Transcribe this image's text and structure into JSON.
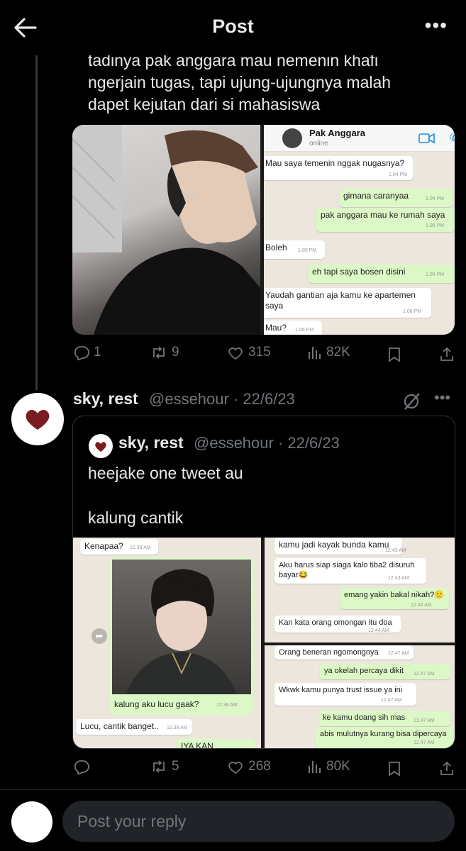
{
  "header": {
    "title": "Post"
  },
  "tweet1": {
    "text_lines": [
      "tadinya pak anggara mau nemenin khafi",
      "ngerjain tugas, tapi ujung-ujungnya malah",
      "dapet kejutan dari si mahasiswa"
    ],
    "chat": {
      "contact_name": "Pak Anggara",
      "status": "online",
      "messages": [
        {
          "dir": "in",
          "text": "Mau saya temenin nggak nugasnya?",
          "time": "1.04 PM"
        },
        {
          "dir": "out",
          "text": "gimana caranyaa",
          "time": "1.04 PM"
        },
        {
          "dir": "out",
          "text": "pak anggara mau ke rumah saya",
          "time": "1.05 PM"
        },
        {
          "dir": "in",
          "text": "Boleh",
          "time": "1.05 PM"
        },
        {
          "dir": "out",
          "text": "eh tapi saya bosen disini",
          "time": "1.06 PM"
        },
        {
          "dir": "in",
          "text": "Yaudah gantian aja kamu ke apartemen",
          "text2": "saya",
          "time": "1.06 PM"
        },
        {
          "dir": "in",
          "text": "Mau?",
          "time": "1.06 PM"
        }
      ]
    },
    "stats": {
      "replies": "1",
      "reposts": "9",
      "likes": "315",
      "views": "82K"
    }
  },
  "tweet2": {
    "name": "sky, rest",
    "handle_date": "@essehour · 22/6/23",
    "quote": {
      "name": "sky, rest",
      "handle_date": "@essehour · 22/6/23",
      "text1": "heejake one tweet au",
      "text2": "kalung cantik",
      "chat_left": {
        "top_msg": {
          "text": "Kenapaa?",
          "time": "12.39 AM"
        },
        "caption": {
          "text": "kalung aku lucu gaak?",
          "time": "12.38 AM"
        },
        "reply": {
          "text": "Lucu, cantik banget..",
          "time": "12.39 AM"
        },
        "out_partial": "IYA KAN"
      },
      "chat_rt": [
        {
          "dir": "in",
          "text": "kamu jadi kayak bunda kamu",
          "time": "12.43 AM"
        },
        {
          "dir": "in",
          "text": "Aku harus siap siaga kalo tiba2 disuruh",
          "text2": "bayar😂",
          "time": "12.43 AM"
        },
        {
          "dir": "out",
          "text": "emang yakin bakal nikah?🙂",
          "time": "12.44 AM"
        },
        {
          "dir": "in",
          "text": "Kan kata orang omongan itu doa",
          "time": "12.44 AM"
        }
      ],
      "chat_rb": [
        {
          "dir": "in",
          "text": "Orang beneran ngomongnya",
          "time": "12.47 AM"
        },
        {
          "dir": "out",
          "text": "ya okelah percaya dikit",
          "time": "12.47 AM"
        },
        {
          "dir": "in",
          "text": "Wkwk kamu punya trust issue ya ini",
          "time": "12.47 AM"
        },
        {
          "dir": "out",
          "text": "ke kamu doang sih mas",
          "time": "12.47 AM"
        },
        {
          "dir": "out",
          "text": "abis mulutnya kurang bisa dipercaya",
          "time": "12.47 AM"
        }
      ]
    },
    "stats": {
      "replies": "",
      "reposts": "5",
      "likes": "268",
      "views": "80K"
    }
  },
  "reply": {
    "placeholder": "Post your reply"
  },
  "colors": {
    "background": "#000000",
    "text": "#e7e9ea",
    "muted": "#71767b",
    "border": "#2f3336",
    "wa_out": "#dcf8c6",
    "wa_in": "#ffffff"
  },
  "icons": [
    "back-arrow-icon",
    "more-icon",
    "reply-icon",
    "repost-icon",
    "like-icon",
    "views-icon",
    "bookmark-icon",
    "share-icon",
    "grok-icon",
    "video-call-icon",
    "heart-avatar-icon"
  ]
}
